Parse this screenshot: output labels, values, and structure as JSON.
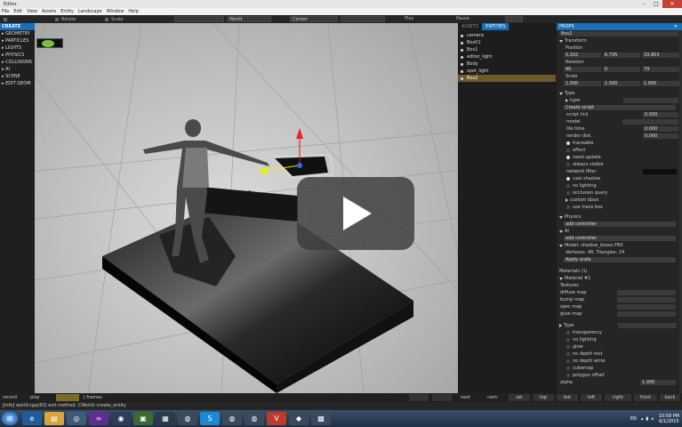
{
  "window": {
    "title": "Editor"
  },
  "menu": [
    "File",
    "Edit",
    "View",
    "Assets",
    "Entity",
    "Landscape",
    "Window",
    "Help"
  ],
  "toolbar": {
    "rotate": "Rotate",
    "scale": "Scale",
    "space": "World",
    "pivot": "Center",
    "play": "Play",
    "pause": "Pause"
  },
  "left_panel": {
    "header": "CREATE",
    "items": [
      "GEOMETRY",
      "PARTICLES",
      "LIGHTS",
      "PHYSICS",
      "COLLISIONS",
      "AI",
      "SCENE",
      "EDIT GEOM"
    ]
  },
  "assets_panel": {
    "tabs": [
      "ASSETS",
      "ENTITIES"
    ],
    "items": [
      "camera",
      "Box01",
      "Box1",
      "editor_light",
      "Body",
      "spot_light",
      "Box2"
    ]
  },
  "props": {
    "header": "PROPS",
    "name": "Box2",
    "transform": {
      "label": "Transform",
      "position_label": "Position",
      "position": [
        "5.202",
        "6.795",
        "33.803"
      ],
      "rotation_label": "Rotation",
      "rotation": [
        "90",
        "0",
        "79"
      ],
      "scale_label": "Scale",
      "scale": [
        "1.000",
        "1.000",
        "1.000"
      ]
    },
    "type_section": {
      "label": "Type",
      "type_row": "type",
      "create_script": "Create script",
      "script_tick": "script tick",
      "script_tick_value": "0.000",
      "model": "model",
      "life_time": "life time",
      "life_time_value": "0.000",
      "render_dist": "render dist.",
      "render_dist_value": "0.000",
      "traceable": "traceable",
      "effect": "effect",
      "need_update": "need update",
      "always_visible": "always visible",
      "network_filter": "network filter",
      "cast_shadow": "cast shadow",
      "no_lighting": "no lighting",
      "occlusion_query": "occlusion query",
      "custom_bbox": "custom bbox",
      "use_trace_box": "use trace box"
    },
    "physics": {
      "label": "Physics",
      "button": "add controller"
    },
    "ai": {
      "label": "AI",
      "button": "add controller"
    },
    "model_section": {
      "label": "Model: shadow_boxes.FBX",
      "info": "Vertexes: 48, Triangles: 24",
      "button": "Apply scale"
    },
    "materials": {
      "label": "Materials (1)",
      "material": "Material #1",
      "textures": "Textures",
      "maps": [
        "diffuse map",
        "bump map",
        "spec map",
        "glow map"
      ]
    },
    "material_type": {
      "label": "Type",
      "flags": [
        "transparency",
        "no lighting",
        "glow",
        "no depth test",
        "no depth write",
        "cubemap",
        "polygon offset"
      ],
      "alpha_label": "alpha",
      "alpha_value": "1.000"
    }
  },
  "bottom_bar": {
    "record": "record",
    "play": "play",
    "frames": "frames",
    "next": "next",
    "cam_label": "cam:",
    "views": [
      "sel",
      "top",
      "bot",
      "left",
      "right",
      "front",
      "back"
    ]
  },
  "status": {
    "text": "[Info] world.cpp(63) exit method: CWorld::create_entity"
  },
  "taskbar": {
    "lang": "EN",
    "time": "10:59 PM",
    "date": "6/1/2015"
  },
  "colors": {
    "accent": "#1a6fb8",
    "selection": "#6d5a2a",
    "viewport_bg": "#cfcfcf"
  }
}
